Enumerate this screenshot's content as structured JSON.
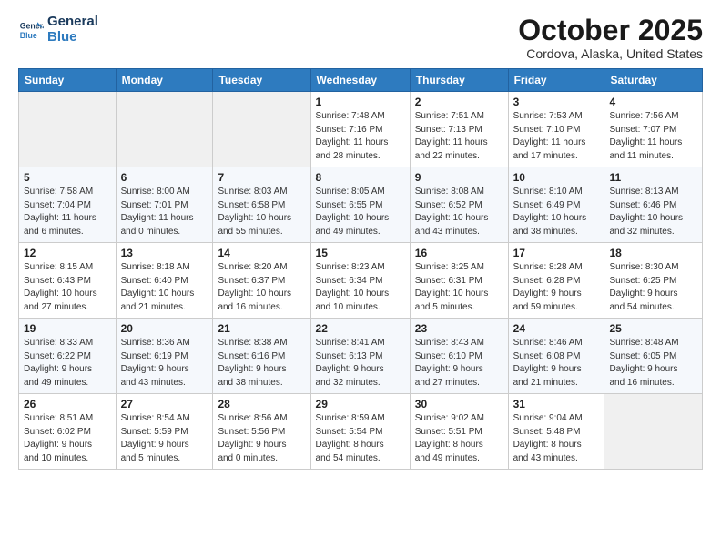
{
  "logo": {
    "line1": "General",
    "line2": "Blue"
  },
  "title": "October 2025",
  "subtitle": "Cordova, Alaska, United States",
  "days_of_week": [
    "Sunday",
    "Monday",
    "Tuesday",
    "Wednesday",
    "Thursday",
    "Friday",
    "Saturday"
  ],
  "weeks": [
    [
      {
        "num": "",
        "info": ""
      },
      {
        "num": "",
        "info": ""
      },
      {
        "num": "",
        "info": ""
      },
      {
        "num": "1",
        "info": "Sunrise: 7:48 AM\nSunset: 7:16 PM\nDaylight: 11 hours\nand 28 minutes."
      },
      {
        "num": "2",
        "info": "Sunrise: 7:51 AM\nSunset: 7:13 PM\nDaylight: 11 hours\nand 22 minutes."
      },
      {
        "num": "3",
        "info": "Sunrise: 7:53 AM\nSunset: 7:10 PM\nDaylight: 11 hours\nand 17 minutes."
      },
      {
        "num": "4",
        "info": "Sunrise: 7:56 AM\nSunset: 7:07 PM\nDaylight: 11 hours\nand 11 minutes."
      }
    ],
    [
      {
        "num": "5",
        "info": "Sunrise: 7:58 AM\nSunset: 7:04 PM\nDaylight: 11 hours\nand 6 minutes."
      },
      {
        "num": "6",
        "info": "Sunrise: 8:00 AM\nSunset: 7:01 PM\nDaylight: 11 hours\nand 0 minutes."
      },
      {
        "num": "7",
        "info": "Sunrise: 8:03 AM\nSunset: 6:58 PM\nDaylight: 10 hours\nand 55 minutes."
      },
      {
        "num": "8",
        "info": "Sunrise: 8:05 AM\nSunset: 6:55 PM\nDaylight: 10 hours\nand 49 minutes."
      },
      {
        "num": "9",
        "info": "Sunrise: 8:08 AM\nSunset: 6:52 PM\nDaylight: 10 hours\nand 43 minutes."
      },
      {
        "num": "10",
        "info": "Sunrise: 8:10 AM\nSunset: 6:49 PM\nDaylight: 10 hours\nand 38 minutes."
      },
      {
        "num": "11",
        "info": "Sunrise: 8:13 AM\nSunset: 6:46 PM\nDaylight: 10 hours\nand 32 minutes."
      }
    ],
    [
      {
        "num": "12",
        "info": "Sunrise: 8:15 AM\nSunset: 6:43 PM\nDaylight: 10 hours\nand 27 minutes."
      },
      {
        "num": "13",
        "info": "Sunrise: 8:18 AM\nSunset: 6:40 PM\nDaylight: 10 hours\nand 21 minutes."
      },
      {
        "num": "14",
        "info": "Sunrise: 8:20 AM\nSunset: 6:37 PM\nDaylight: 10 hours\nand 16 minutes."
      },
      {
        "num": "15",
        "info": "Sunrise: 8:23 AM\nSunset: 6:34 PM\nDaylight: 10 hours\nand 10 minutes."
      },
      {
        "num": "16",
        "info": "Sunrise: 8:25 AM\nSunset: 6:31 PM\nDaylight: 10 hours\nand 5 minutes."
      },
      {
        "num": "17",
        "info": "Sunrise: 8:28 AM\nSunset: 6:28 PM\nDaylight: 9 hours\nand 59 minutes."
      },
      {
        "num": "18",
        "info": "Sunrise: 8:30 AM\nSunset: 6:25 PM\nDaylight: 9 hours\nand 54 minutes."
      }
    ],
    [
      {
        "num": "19",
        "info": "Sunrise: 8:33 AM\nSunset: 6:22 PM\nDaylight: 9 hours\nand 49 minutes."
      },
      {
        "num": "20",
        "info": "Sunrise: 8:36 AM\nSunset: 6:19 PM\nDaylight: 9 hours\nand 43 minutes."
      },
      {
        "num": "21",
        "info": "Sunrise: 8:38 AM\nSunset: 6:16 PM\nDaylight: 9 hours\nand 38 minutes."
      },
      {
        "num": "22",
        "info": "Sunrise: 8:41 AM\nSunset: 6:13 PM\nDaylight: 9 hours\nand 32 minutes."
      },
      {
        "num": "23",
        "info": "Sunrise: 8:43 AM\nSunset: 6:10 PM\nDaylight: 9 hours\nand 27 minutes."
      },
      {
        "num": "24",
        "info": "Sunrise: 8:46 AM\nSunset: 6:08 PM\nDaylight: 9 hours\nand 21 minutes."
      },
      {
        "num": "25",
        "info": "Sunrise: 8:48 AM\nSunset: 6:05 PM\nDaylight: 9 hours\nand 16 minutes."
      }
    ],
    [
      {
        "num": "26",
        "info": "Sunrise: 8:51 AM\nSunset: 6:02 PM\nDaylight: 9 hours\nand 10 minutes."
      },
      {
        "num": "27",
        "info": "Sunrise: 8:54 AM\nSunset: 5:59 PM\nDaylight: 9 hours\nand 5 minutes."
      },
      {
        "num": "28",
        "info": "Sunrise: 8:56 AM\nSunset: 5:56 PM\nDaylight: 9 hours\nand 0 minutes."
      },
      {
        "num": "29",
        "info": "Sunrise: 8:59 AM\nSunset: 5:54 PM\nDaylight: 8 hours\nand 54 minutes."
      },
      {
        "num": "30",
        "info": "Sunrise: 9:02 AM\nSunset: 5:51 PM\nDaylight: 8 hours\nand 49 minutes."
      },
      {
        "num": "31",
        "info": "Sunrise: 9:04 AM\nSunset: 5:48 PM\nDaylight: 8 hours\nand 43 minutes."
      },
      {
        "num": "",
        "info": ""
      }
    ]
  ]
}
